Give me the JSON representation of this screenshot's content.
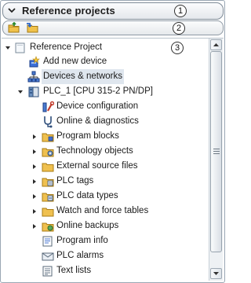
{
  "panel": {
    "title": "Reference projects"
  },
  "callouts": [
    "1",
    "2",
    "3"
  ],
  "toolbar": {
    "buttons": [
      {
        "name": "open-reference-project-icon"
      },
      {
        "name": "close-reference-project-icon"
      }
    ]
  },
  "tree": [
    {
      "label": "Reference Project",
      "icon": "project-icon",
      "expander": "expanded"
    },
    {
      "label": "Add new device",
      "icon": "add-device-icon",
      "expander": "none"
    },
    {
      "label": "Devices & networks",
      "icon": "network-icon",
      "expander": "none",
      "selected": true
    },
    {
      "label": "PLC_1 [CPU 315-2 PN/DP]",
      "icon": "plc-icon",
      "expander": "expanded"
    },
    {
      "label": "Device configuration",
      "icon": "device-config-icon",
      "expander": "none"
    },
    {
      "label": "Online & diagnostics",
      "icon": "diagnostics-icon",
      "expander": "none"
    },
    {
      "label": "Program blocks",
      "icon": "folder-icon",
      "expander": "collapsed"
    },
    {
      "label": "Technology objects",
      "icon": "technology-icon",
      "expander": "collapsed"
    },
    {
      "label": "External source files",
      "icon": "folder-icon",
      "expander": "collapsed"
    },
    {
      "label": "PLC tags",
      "icon": "plc-tags-icon",
      "expander": "collapsed"
    },
    {
      "label": "PLC data types",
      "icon": "data-types-icon",
      "expander": "collapsed"
    },
    {
      "label": "Watch and force tables",
      "icon": "folder-icon",
      "expander": "collapsed"
    },
    {
      "label": "Online backups",
      "icon": "backup-icon",
      "expander": "collapsed"
    },
    {
      "label": "Program info",
      "icon": "program-info-icon",
      "expander": "none"
    },
    {
      "label": "PLC alarms",
      "icon": "alarms-icon",
      "expander": "none"
    },
    {
      "label": "Text lists",
      "icon": "text-lists-icon",
      "expander": "none"
    }
  ],
  "colors": {
    "selection": "#dfe6ee",
    "folder": "#e8b84a",
    "frame_border": "#7f8b97"
  }
}
